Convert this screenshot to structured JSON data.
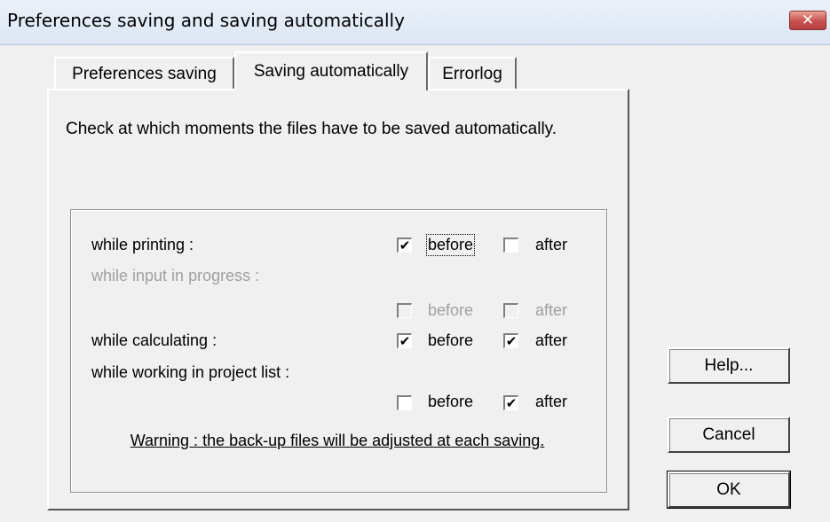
{
  "window": {
    "title": "Preferences saving and saving automatically",
    "close_icon": "close-icon"
  },
  "tabs": [
    {
      "label": "Preferences saving",
      "active": false
    },
    {
      "label": "Saving automatically",
      "active": true
    },
    {
      "label": "Errorlog",
      "active": false
    }
  ],
  "panel": {
    "intro": "Check at which moments the files have to be saved automatically.",
    "rows": [
      {
        "label": "while printing :",
        "enabled": true,
        "before": {
          "label": "before",
          "checked": true
        },
        "after": {
          "label": "after",
          "checked": false
        }
      },
      {
        "label": "while input in progress :",
        "enabled": false,
        "before": {
          "label": "before",
          "checked": false
        },
        "after": {
          "label": "after",
          "checked": false
        }
      },
      {
        "label": "while calculating :",
        "enabled": true,
        "before": {
          "label": "before",
          "checked": true
        },
        "after": {
          "label": "after",
          "checked": true
        }
      },
      {
        "label": "while working in project list :",
        "enabled": true,
        "before": {
          "label": "before",
          "checked": false
        },
        "after": {
          "label": "after",
          "checked": true
        }
      }
    ],
    "warning": "Warning : the back-up files will be adjusted at each saving."
  },
  "buttons": {
    "help": "Help...",
    "cancel": "Cancel",
    "ok": "OK"
  },
  "check_glyph": "✔"
}
